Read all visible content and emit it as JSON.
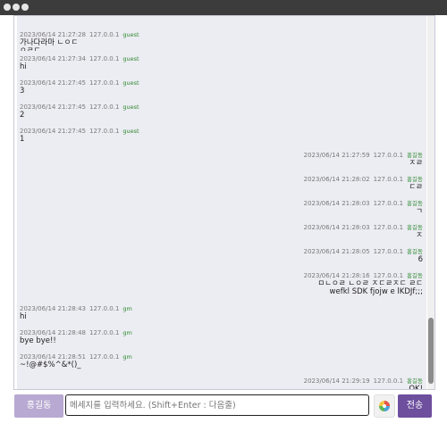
{
  "window": {
    "controls": [
      "close",
      "minimize",
      "zoom"
    ]
  },
  "messages": [
    {
      "side": "left",
      "time": "2023/06/14 21:27:28",
      "ip": "127.0.0.1",
      "user": "guest",
      "text": "가나다라마 ㄴㅇㄷ\nㅇㄹㄷ"
    },
    {
      "side": "left",
      "time": "2023/06/14 21:27:34",
      "ip": "127.0.0.1",
      "user": "guest",
      "text": "hi"
    },
    {
      "side": "left",
      "time": "2023/06/14 21:27:45",
      "ip": "127.0.0.1",
      "user": "guest",
      "text": "3"
    },
    {
      "side": "left",
      "time": "2023/06/14 21:27:45",
      "ip": "127.0.0.1",
      "user": "guest",
      "text": "2"
    },
    {
      "side": "left",
      "time": "2023/06/14 21:27:45",
      "ip": "127.0.0.1",
      "user": "guest",
      "text": "1"
    },
    {
      "side": "right",
      "time": "2023/06/14 21:27:59",
      "ip": "127.0.0.1",
      "user": "홍길동",
      "text": "ㅈㄹ"
    },
    {
      "side": "right",
      "time": "2023/06/14 21:28:02",
      "ip": "127.0.0.1",
      "user": "홍길동",
      "text": "ㄷㄹ"
    },
    {
      "side": "right",
      "time": "2023/06/14 21:28:03",
      "ip": "127.0.0.1",
      "user": "홍길동",
      "text": "ㄱ"
    },
    {
      "side": "right",
      "time": "2023/06/14 21:28:03",
      "ip": "127.0.0.1",
      "user": "홍길동",
      "text": "ㅈ"
    },
    {
      "side": "right",
      "time": "2023/06/14 21:28:05",
      "ip": "127.0.0.1",
      "user": "홍길동",
      "text": "6"
    },
    {
      "side": "right",
      "time": "2023/06/14 21:28:16",
      "ip": "127.0.0.1",
      "user": "홍길동",
      "text": "ㅁㄴㅇㄹ ㄴㅇㄹ ㅈㄷㄹㅈㄷ ㄹㄷ\nwefkl SDK fjojw e lKDJf;;;"
    },
    {
      "side": "left",
      "time": "2023/06/14 21:28:43",
      "ip": "127.0.0.1",
      "user": "gm",
      "text": "hi"
    },
    {
      "side": "left",
      "time": "2023/06/14 21:28:48",
      "ip": "127.0.0.1",
      "user": "gm",
      "text": "bye bye!!"
    },
    {
      "side": "left",
      "time": "2023/06/14 21:28:51",
      "ip": "127.0.0.1",
      "user": "gm",
      "text": "~!@#$%^&*()_"
    },
    {
      "side": "right",
      "time": "2023/06/14 21:29:19",
      "ip": "127.0.0.1",
      "user": "홍길동",
      "text": "OK!"
    }
  ],
  "composer": {
    "name_label": "홍길동",
    "input_placeholder": "메세지를 입력하세요. (Shift+Enter : 다음줄)",
    "input_value": "",
    "emoji_icon": "palette-emoji-icon",
    "send_label": "전송"
  },
  "colors": {
    "message_bg": "#ececf3",
    "user_name": "#2e8b2e",
    "name_button": "#b7a9d1",
    "send_button": "#6d4f9e"
  }
}
